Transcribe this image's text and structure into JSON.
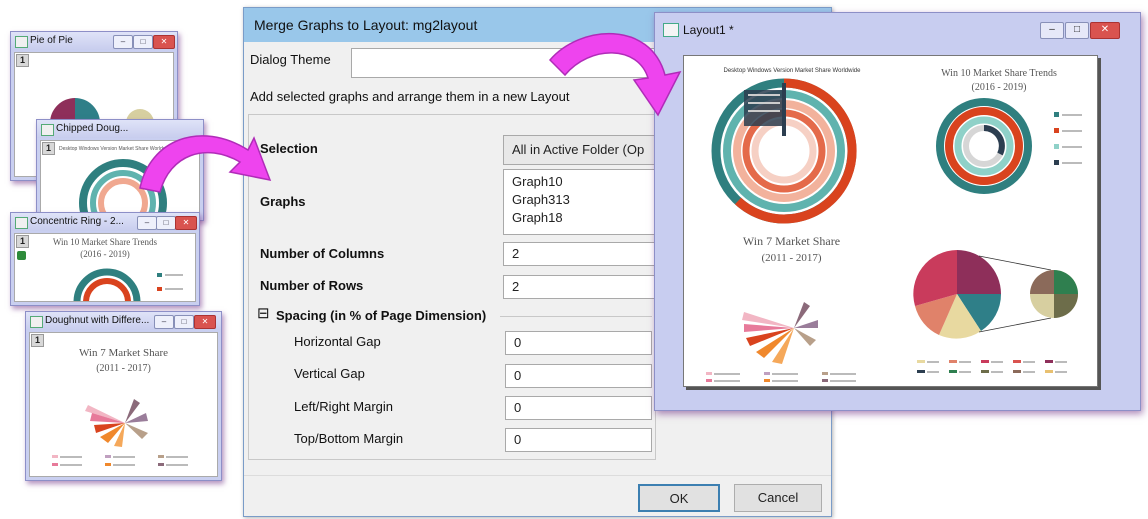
{
  "graph_windows": [
    {
      "title": "Pie of Pie",
      "badge": "1"
    },
    {
      "title": "Chipped Doug...",
      "badge": "1",
      "inner_text": "Desktop Windows Version Market Share Worldwide"
    },
    {
      "title": "Concentric Ring - 2...",
      "badge": "1",
      "chart_title": "Win 10 Market Share Trends",
      "chart_subtitle": "(2016 - 2019)"
    },
    {
      "title": "Doughnut with Differe...",
      "badge": "1",
      "chart_title": "Win 7 Market Share",
      "chart_subtitle": "(2011 - 2017)"
    }
  ],
  "dialog": {
    "title": "Merge Graphs to Layout: mg2layout",
    "theme_label": "Dialog Theme",
    "theme_value": "",
    "description": "Add selected graphs and arrange them in a new Layout",
    "selection_label": "Selection",
    "selection_value": "All in Active Folder (Op",
    "graphs_label": "Graphs",
    "graphs": [
      "Graph10",
      "Graph313",
      "Graph18"
    ],
    "columns_label": "Number of Columns",
    "columns_value": "2",
    "rows_label": "Number of Rows",
    "rows_value": "2",
    "spacing_toggle": "⊟",
    "spacing_label": "Spacing (in % of Page Dimension)",
    "hgap_label": "Horizontal Gap",
    "hgap_value": "0",
    "vgap_label": "Vertical Gap",
    "vgap_value": "0",
    "lrmargin_label": "Left/Right Margin",
    "lrmargin_value": "0",
    "tbmargin_label": "Top/Bottom Margin",
    "tbmargin_value": "0",
    "ok_label": "OK",
    "cancel_label": "Cancel"
  },
  "layout_window": {
    "title": "Layout1 *",
    "panel1_title": "Desktop Windows Version Market Share Worldwide",
    "panel2_title": "Win 10 Market Share Trends",
    "panel2_subtitle": "(2016 - 2019)",
    "panel3_title": "Win 7 Market Share",
    "panel3_subtitle": "(2011 - 2017)"
  },
  "colors": {
    "accent_arrow": "#ee44ee",
    "dialog_titlebar": "#99c7ea",
    "window_frame": "#c8cdf0",
    "teal": "#2f7f7f",
    "red": "#d9431e",
    "maroon": "#8e2f5a"
  }
}
